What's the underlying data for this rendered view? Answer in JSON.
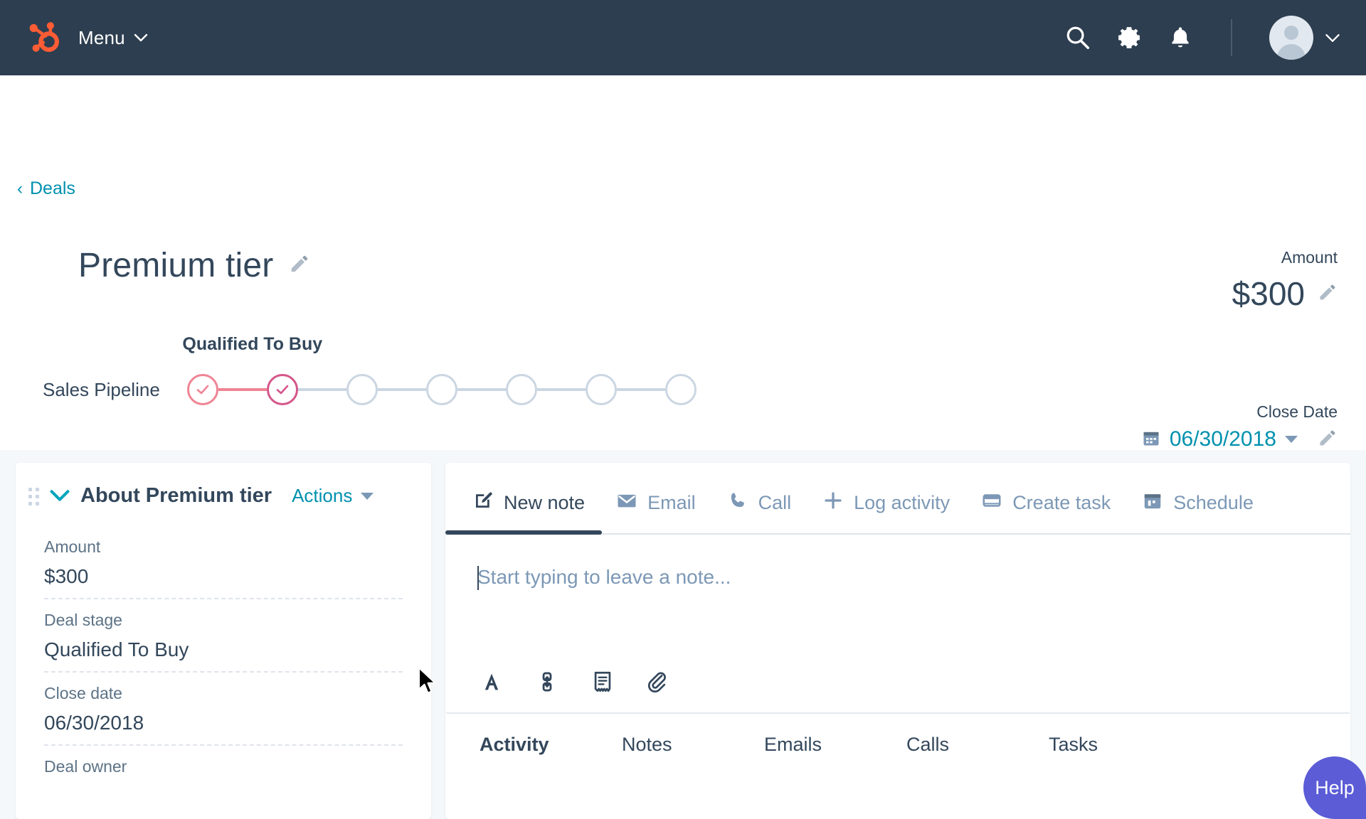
{
  "topnav": {
    "menu_label": "Menu",
    "logo_icon": "hubspot-sprocket-logo",
    "search_icon": "search-icon",
    "settings_icon": "gear-icon",
    "notifications_icon": "bell-icon",
    "avatar_icon": "user-avatar",
    "avatar_caret_icon": "chevron-down-icon",
    "background_color": "#2d3e50"
  },
  "breadcrumb": {
    "back_icon": "chevron-left-icon",
    "label": "Deals",
    "color": "#0091ae"
  },
  "deal": {
    "title": "Premium tier",
    "title_edit_icon": "pencil-icon",
    "amount_label": "Amount",
    "amount_value": "$300",
    "amount_edit_icon": "pencil-icon",
    "close_date_label": "Close Date",
    "close_date_value": "06/30/2018",
    "close_date_icon": "calendar-icon",
    "close_date_caret_icon": "chevron-down-icon",
    "close_date_edit_icon": "pencil-icon"
  },
  "pipeline": {
    "name": "Sales Pipeline",
    "current_stage_label": "Qualified To Buy",
    "total_stages": 7,
    "completed_stages": 2,
    "stage_colors": {
      "first": "#ef8494",
      "current": "#d4568a",
      "inactive": "#cbd6e2"
    }
  },
  "about_card": {
    "collapse_icon": "chevron-down-icon",
    "drag_handle_icon": "drag-handle-icon",
    "title": "About Premium tier",
    "actions_label": "Actions",
    "actions_caret_icon": "chevron-down-icon",
    "properties": [
      {
        "label": "Amount",
        "value": "$300"
      },
      {
        "label": "Deal stage",
        "value": "Qualified To Buy"
      },
      {
        "label": "Close date",
        "value": "06/30/2018"
      },
      {
        "label": "Deal owner",
        "value": ""
      }
    ]
  },
  "activity_panel": {
    "tabs": [
      {
        "label": "New note",
        "icon": "note-edit-icon",
        "active": true
      },
      {
        "label": "Email",
        "icon": "envelope-icon",
        "active": false
      },
      {
        "label": "Call",
        "icon": "phone-icon",
        "active": false
      },
      {
        "label": "Log activity",
        "icon": "plus-icon",
        "active": false
      },
      {
        "label": "Create task",
        "icon": "task-icon",
        "active": false
      },
      {
        "label": "Schedule",
        "icon": "calendar-icon",
        "active": false
      }
    ],
    "note_placeholder": "Start typing to leave a note...",
    "editor_tools": [
      {
        "icon": "text-format-icon",
        "glyph": "A"
      },
      {
        "icon": "insert-link-icon",
        "glyph": ""
      },
      {
        "icon": "template-document-icon",
        "glyph": ""
      },
      {
        "icon": "paperclip-attach-icon",
        "glyph": ""
      }
    ],
    "bottom_tabs": [
      {
        "label": "Activity",
        "active": true
      },
      {
        "label": "Notes",
        "active": false
      },
      {
        "label": "Emails",
        "active": false
      },
      {
        "label": "Calls",
        "active": false
      },
      {
        "label": "Tasks",
        "active": false
      }
    ]
  },
  "help": {
    "label": "Help",
    "color": "#5b5cd6"
  }
}
